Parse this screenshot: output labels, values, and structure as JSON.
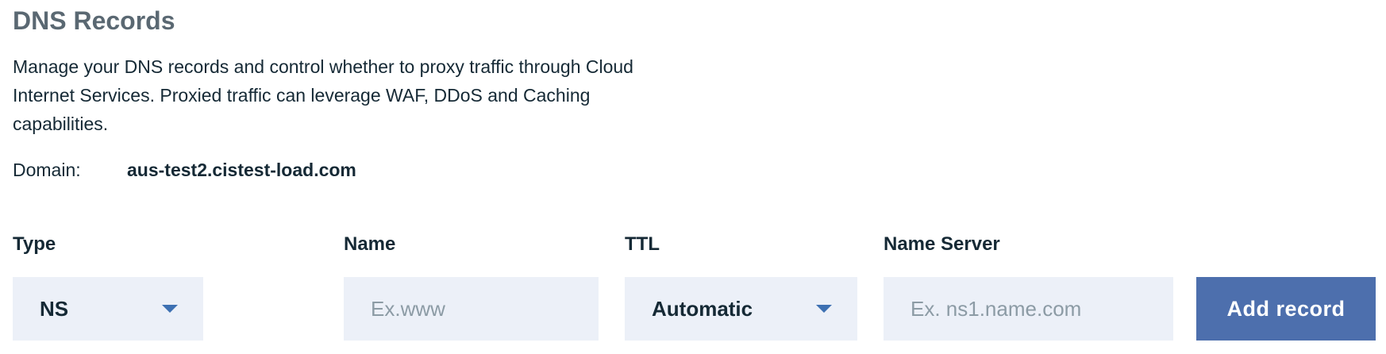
{
  "header": {
    "title": "DNS Records",
    "description_line1": "Manage your DNS records and control whether to proxy traffic through Cloud",
    "description_line2": "Internet Services. Proxied traffic can leverage WAF, DDoS and Caching",
    "description_line3": "capabilities."
  },
  "domain": {
    "label": "Domain:",
    "value": "aus-test2.cistest-load.com"
  },
  "form": {
    "type": {
      "label": "Type",
      "value": "NS",
      "icon": "chevron-down-icon"
    },
    "name": {
      "label": "Name",
      "value": "",
      "placeholder": "Ex.www"
    },
    "ttl": {
      "label": "TTL",
      "value": "Automatic",
      "icon": "chevron-down-icon"
    },
    "name_server": {
      "label": "Name Server",
      "value": "",
      "placeholder": "Ex. ns1.name.com"
    },
    "add_button_label": "Add record"
  },
  "colors": {
    "title": "#5a6872",
    "text": "#152935",
    "field_background": "#ecf0f8",
    "caret": "#3d70b2",
    "button_background": "#4d6fad",
    "button_text": "#ffffff",
    "placeholder": "#8c9ba5"
  }
}
